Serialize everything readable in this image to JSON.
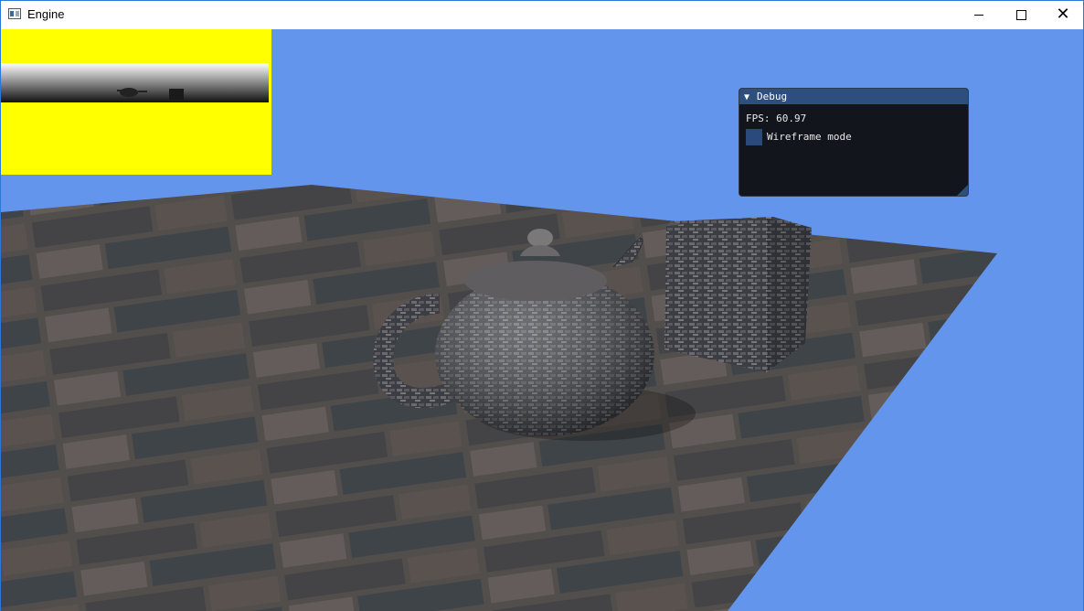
{
  "window": {
    "title": "Engine",
    "controls": {
      "minimize": "minimize-icon",
      "maximize": "maximize-icon",
      "close": "close-icon"
    }
  },
  "scene": {
    "background_color": "#6495ed",
    "objects": [
      "floor",
      "teapot",
      "cube"
    ]
  },
  "depth_preview": {
    "background_color": "#ffff00"
  },
  "debug_panel": {
    "title": "Debug",
    "collapse_icon": "triangle-down-icon",
    "fps_label": "FPS: 60.97",
    "checkbox_label": "Wireframe mode",
    "checkbox_checked": false
  }
}
